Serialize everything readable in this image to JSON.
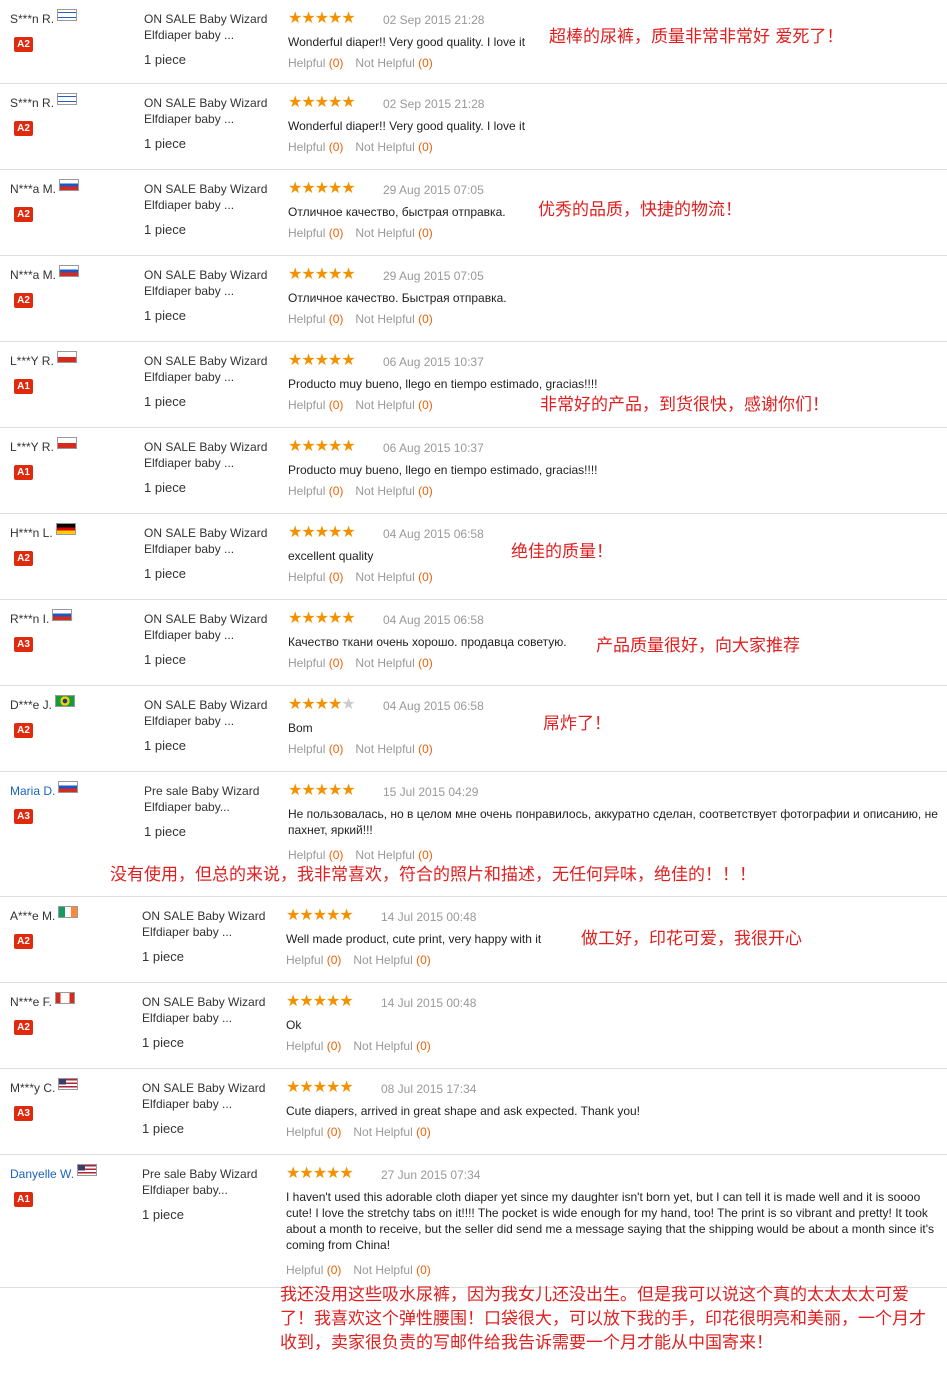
{
  "helpful_label": "Helpful",
  "not_helpful_label": "Not Helpful",
  "colors": {
    "star": "#f39200",
    "badge": "#e02a0e",
    "annotation": "#e02020",
    "link": "#1a63c2"
  },
  "reviews": [
    {
      "user": "S***n R.",
      "flag": "israel",
      "level": "A2",
      "product": "ON SALE Baby Wizard Elfdiaper baby ...",
      "qty": "1 piece",
      "rating": 5,
      "date": "02 Sep 2015 21:28",
      "text": "Wonderful diaper!! Very good quality. I love it",
      "helpful": "(0)",
      "not_helpful": "(0)"
    },
    {
      "user": "S***n R.",
      "flag": "israel",
      "level": "A2",
      "product": "ON SALE Baby Wizard Elfdiaper baby ...",
      "qty": "1 piece",
      "rating": 5,
      "date": "02 Sep 2015 21:28",
      "text": "Wonderful diaper!! Very good quality. I love it",
      "helpful": "(0)",
      "not_helpful": "(0)"
    },
    {
      "user": "N***a M.",
      "flag": "russia",
      "level": "A2",
      "product": "ON SALE Baby Wizard Elfdiaper baby ...",
      "qty": "1 piece",
      "rating": 5,
      "date": "29 Aug 2015 07:05",
      "text": "Отличное качество, быстрая отправка.",
      "helpful": "(0)",
      "not_helpful": "(0)"
    },
    {
      "user": "N***a M.",
      "flag": "russia",
      "level": "A2",
      "product": "ON SALE Baby Wizard Elfdiaper baby ...",
      "qty": "1 piece",
      "rating": 5,
      "date": "29 Aug 2015 07:05",
      "text": "Отличное качество. Быстрая отправка.",
      "helpful": "(0)",
      "not_helpful": "(0)"
    },
    {
      "user": "L***Y R.",
      "flag": "chile",
      "level": "A1",
      "product": "ON SALE Baby Wizard Elfdiaper baby ...",
      "qty": "1 piece",
      "rating": 5,
      "date": "06 Aug 2015 10:37",
      "text": "Producto muy bueno, llego en tiempo estimado, gracias!!!!",
      "helpful": "(0)",
      "not_helpful": "(0)"
    },
    {
      "user": "L***Y R.",
      "flag": "chile",
      "level": "A1",
      "product": "ON SALE Baby Wizard Elfdiaper baby ...",
      "qty": "1 piece",
      "rating": 5,
      "date": "06 Aug 2015 10:37",
      "text": "Producto muy bueno, llego en tiempo estimado, gracias!!!!",
      "helpful": "(0)",
      "not_helpful": "(0)"
    },
    {
      "user": "H***n L.",
      "flag": "germany",
      "level": "A2",
      "product": "ON SALE Baby Wizard Elfdiaper baby ...",
      "qty": "1 piece",
      "rating": 5,
      "date": "04 Aug 2015 06:58",
      "text": "excellent quality",
      "helpful": "(0)",
      "not_helpful": "(0)"
    },
    {
      "user": "R***n I.",
      "flag": "russia",
      "level": "A3",
      "product": "ON SALE Baby Wizard Elfdiaper baby ...",
      "qty": "1 piece",
      "rating": 5,
      "date": "04 Aug 2015 06:58",
      "text": "Качество ткани очень хорошо. продавца советую.",
      "helpful": "(0)",
      "not_helpful": "(0)"
    },
    {
      "user": "D***e J.",
      "flag": "brazil",
      "level": "A2",
      "product": "ON SALE Baby Wizard Elfdiaper baby ...",
      "qty": "1 piece",
      "rating": 4,
      "date": "04 Aug 2015 06:58",
      "text": "Bom",
      "helpful": "(0)",
      "not_helpful": "(0)"
    },
    {
      "user": "Maria D.",
      "flag": "russia",
      "link": true,
      "level": "A3",
      "product": "Pre sale Baby Wizard Elfdiaper baby...",
      "qty": "1 piece",
      "rating": 5,
      "date": "15 Jul 2015 04:29",
      "text": "Не пользовалась, но в целом мне очень понравилось, аккуратно сделан, соответствует фотографии и описанию, не пахнет, яркий!!!",
      "helpful": "(0)",
      "not_helpful": "(0)"
    },
    {
      "user": "A***e M.",
      "flag": "ireland",
      "level": "A2",
      "product": "ON SALE Baby Wizard Elfdiaper baby ...",
      "qty": "1 piece",
      "rating": 5,
      "date": "14 Jul 2015 00:48",
      "text": "Well made product, cute print, very happy with it",
      "helpful": "(0)",
      "not_helpful": "(0)"
    },
    {
      "user": "N***e F.",
      "flag": "canada",
      "level": "A2",
      "product": "ON SALE Baby Wizard Elfdiaper baby ...",
      "qty": "1 piece",
      "rating": 5,
      "date": "14 Jul 2015 00:48",
      "text": "Ok",
      "helpful": "(0)",
      "not_helpful": "(0)"
    },
    {
      "user": "M***y C.",
      "flag": "usa",
      "level": "A3",
      "product": "ON SALE Baby Wizard Elfdiaper baby ...",
      "qty": "1 piece",
      "rating": 5,
      "date": "08 Jul 2015 17:34",
      "text": "Cute diapers, arrived in great shape and ask expected. Thank you!",
      "helpful": "(0)",
      "not_helpful": "(0)"
    },
    {
      "user": "Danyelle W.",
      "flag": "usa",
      "link": true,
      "level": "A1",
      "product": "Pre sale Baby Wizard Elfdiaper baby...",
      "qty": "1 piece",
      "rating": 5,
      "date": "27 Jun 2015 07:34",
      "text": "I haven't used this adorable cloth diaper yet since my daughter isn't born yet, but I can tell it is made well and it is soooo cute! I love the stretchy tabs on it!!!! The pocket is wide enough for my hand, too! The print is so vibrant and pretty! It took about a month to receive, but the seller did send me a message saying that the shipping would be about a month since it's coming from China!",
      "helpful": "(0)",
      "not_helpful": "(0)"
    }
  ],
  "annotations": [
    "超棒的尿裤，质量非常非常好 爱死了！",
    "优秀的品质，快捷的物流！",
    "非常好的产品，到货很快，感谢你们！",
    "绝佳的质量！",
    "产品质量很好，向大家推荐",
    "屌炸了！",
    "没有使用，但总的来说，我非常喜欢，符合的照片和描述，无任何异味，绝佳的！！！",
    "做工好，印花可爱，我很开心",
    "我还没用这些吸水尿裤，因为我女儿还没出生。但是我可以说这个真的太太太太可爱了！我喜欢这个弹性腰围！口袋很大，可以放下我的手，印花很明亮和美丽，一个月才收到，卖家很负责的写邮件给我告诉需要一个月才能从中国寄来！"
  ]
}
